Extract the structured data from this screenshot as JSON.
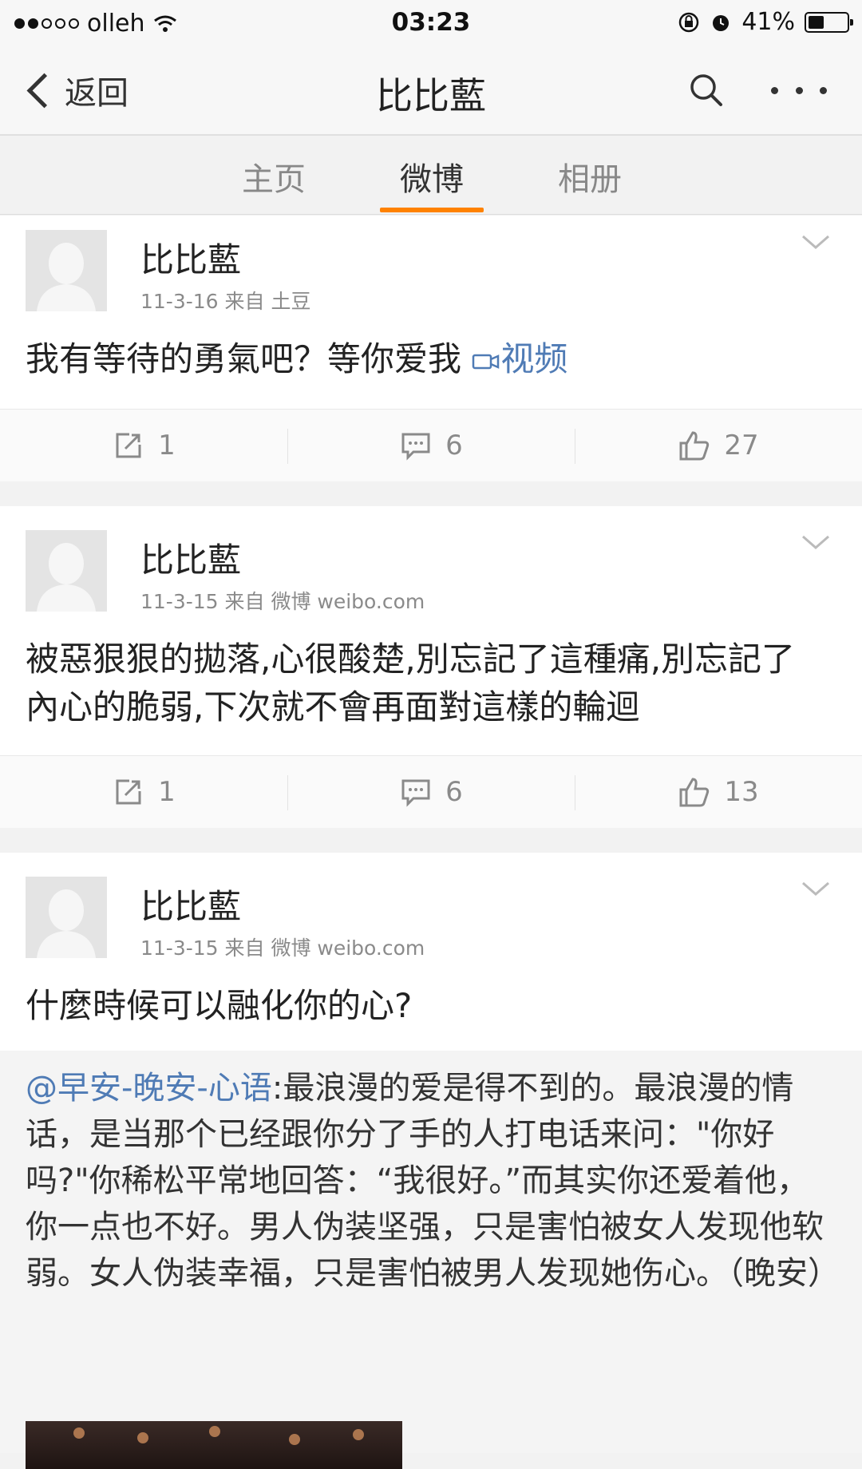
{
  "status_bar": {
    "carrier": "olleh",
    "time": "03:23",
    "battery_percent": "41%",
    "battery_level": 0.41,
    "icons": [
      "signal-dots-icon",
      "wifi-icon",
      "rotation-lock-icon",
      "alarm-icon",
      "battery-icon"
    ]
  },
  "nav": {
    "back_label": "返回",
    "title": "比比藍",
    "icons": [
      "back-chevron-icon",
      "search-icon",
      "more-icon"
    ]
  },
  "tabs": [
    {
      "label": "主页",
      "active": false
    },
    {
      "label": "微博",
      "active": true
    },
    {
      "label": "相册",
      "active": false
    }
  ],
  "colors": {
    "accent": "#ff8200",
    "link": "#4f7bb5",
    "background": "#f2f2f2"
  },
  "posts": [
    {
      "author": "比比藍",
      "meta": "11-3-16 来自 土豆",
      "text": "我有等待的勇氣吧？等你爱我",
      "video_label": "视频",
      "reposts": "1",
      "comments": "6",
      "likes": "27"
    },
    {
      "author": "比比藍",
      "meta": "11-3-15 来自 微博 weibo.com",
      "text": "被惡狠狠的拋落,心很酸楚,別忘記了這種痛,別忘記了內心的脆弱,下次就不會再面對這樣的輪迴",
      "reposts": "1",
      "comments": "6",
      "likes": "13"
    },
    {
      "author": "比比藍",
      "meta": "11-3-15 来自 微博 weibo.com",
      "text": "什麼時候可以融化你的心?",
      "repost": {
        "mention": "@早安-晚安-心语",
        "text": ":最浪漫的爱是得不到的。最浪漫的情话，是当那个已经跟你分了手的人打电话来问：\"你好吗?\"你稀松平常地回答：“我很好。”而其实你还爱着他，你一点也不好。男人伪装坚强，只是害怕被女人发现他软弱。女人伪装幸福，只是害怕被男人发现她伤心。（晚安）"
      }
    }
  ]
}
